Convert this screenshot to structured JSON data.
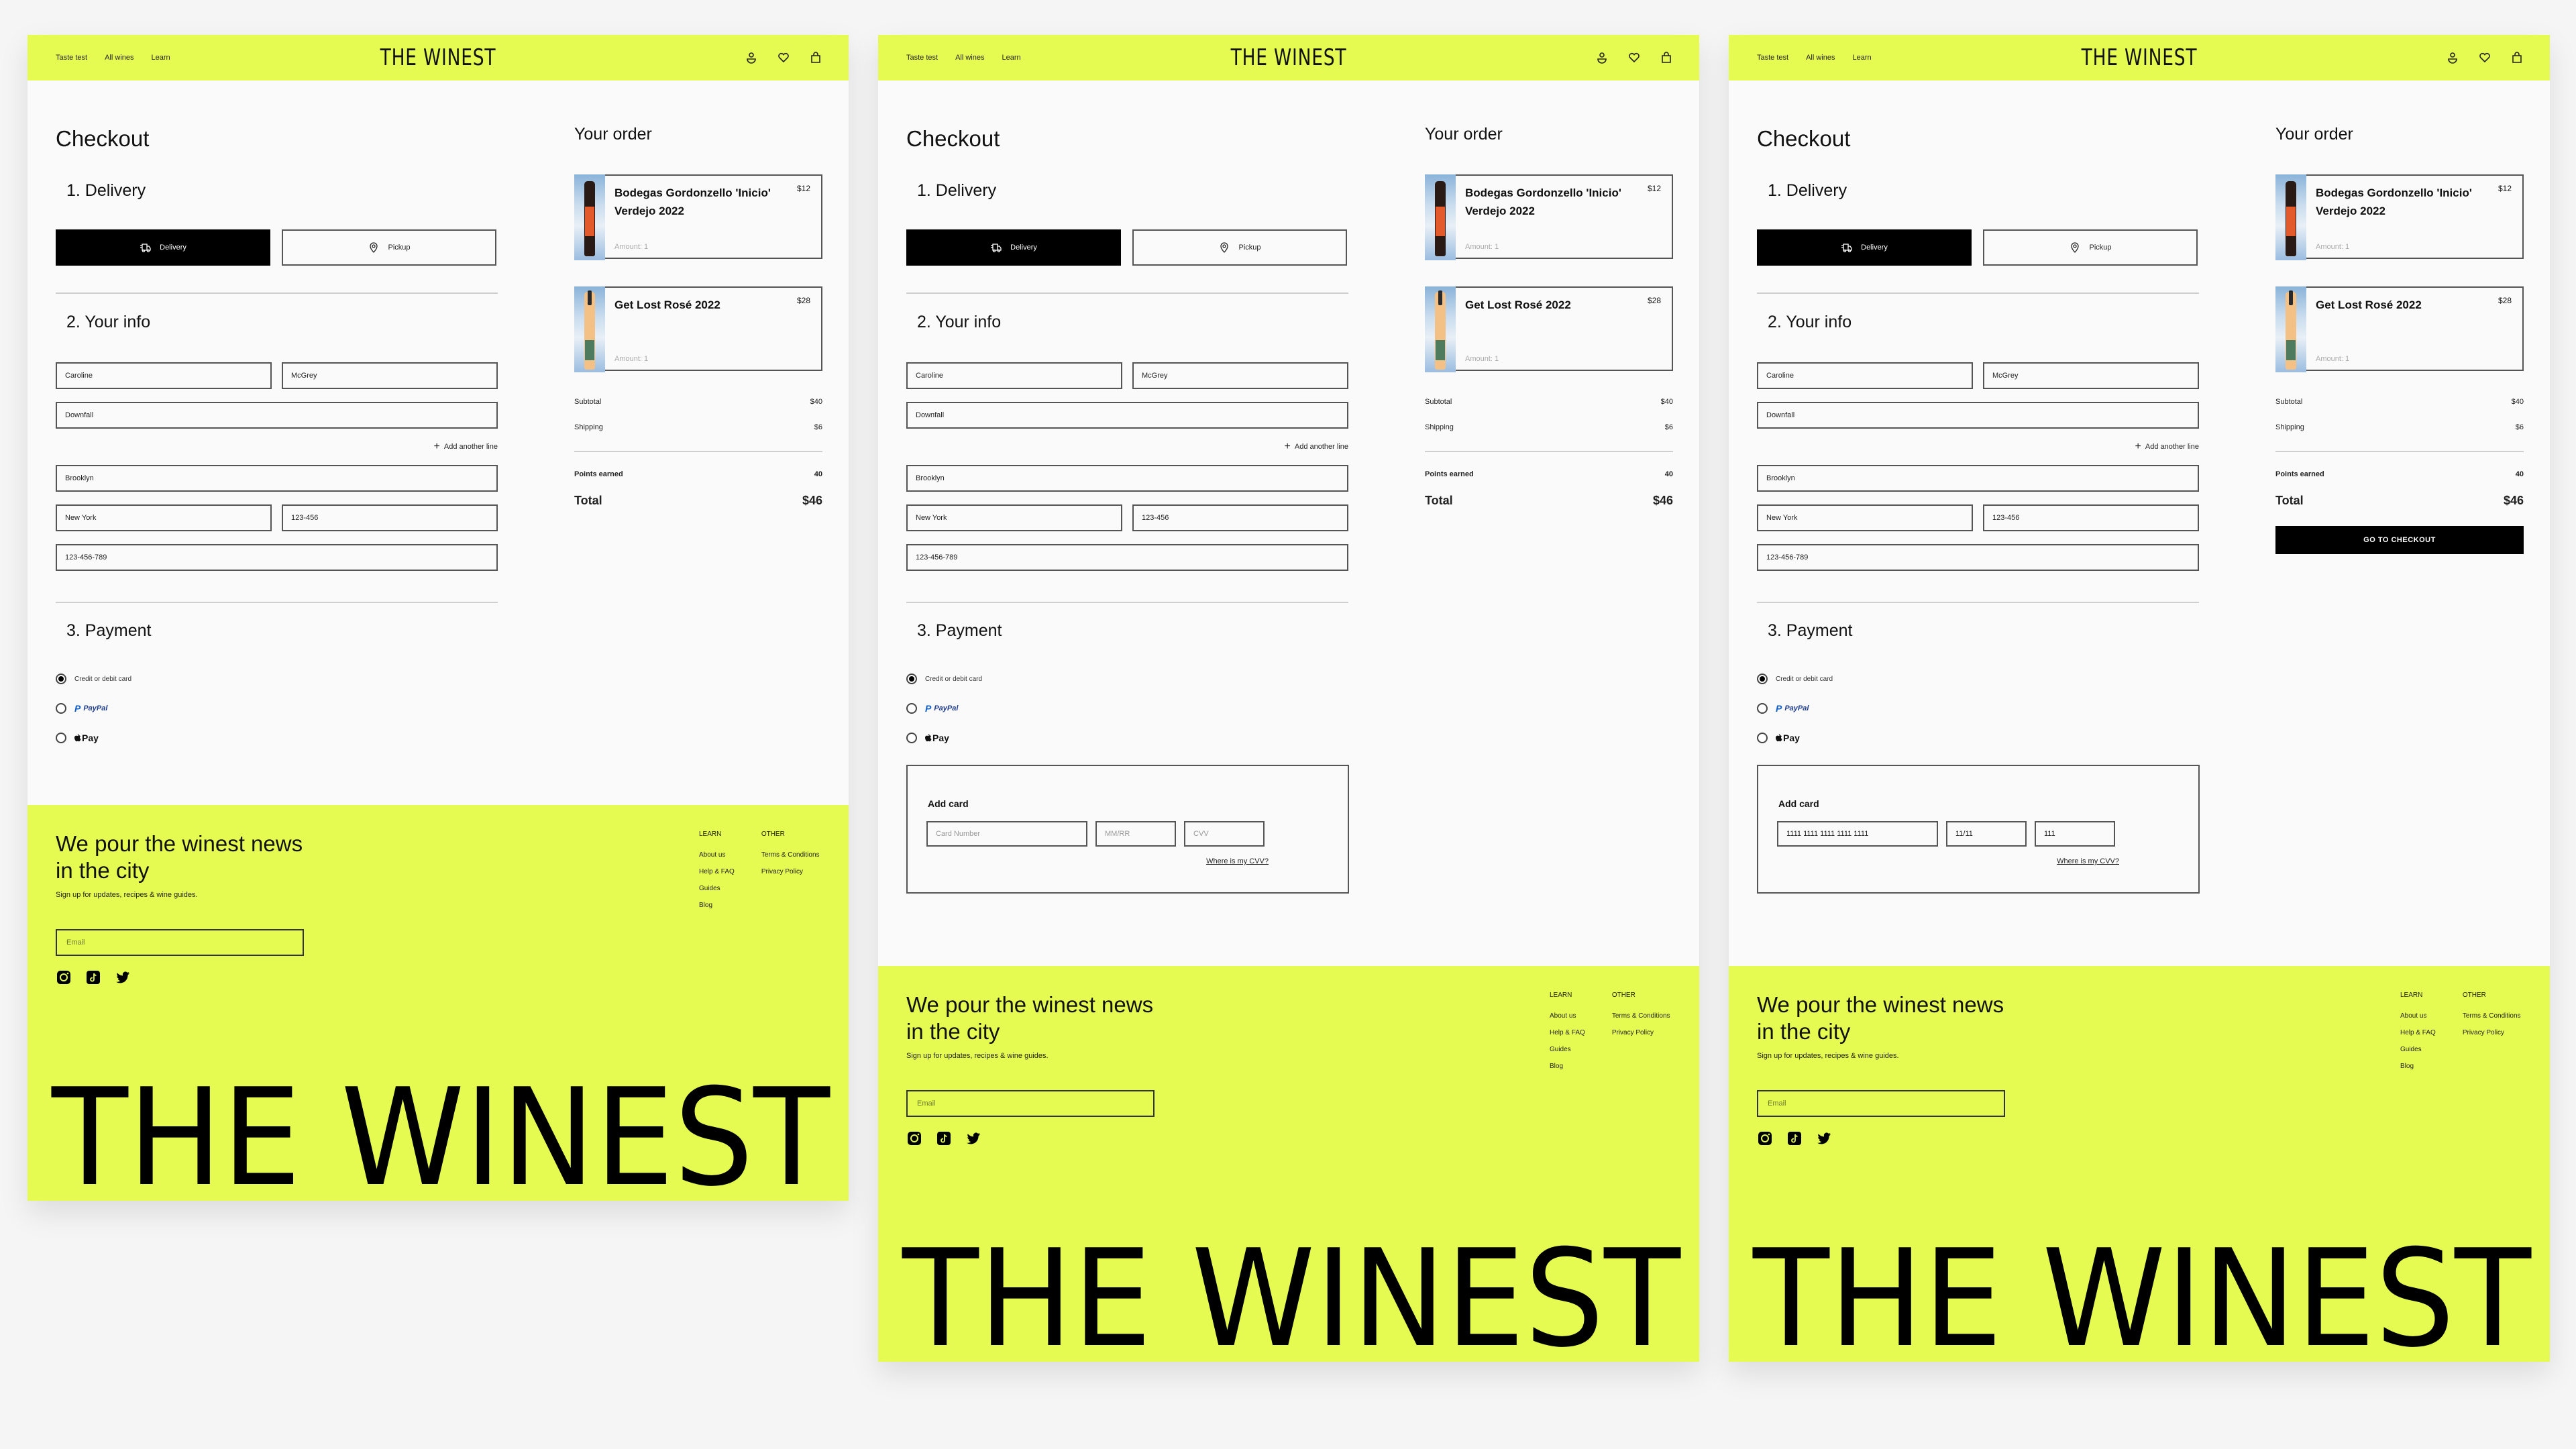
{
  "colors": {
    "accent": "#e6fb52",
    "ink": "#000000",
    "paypal_blue": "#1d3b8f"
  },
  "nav": {
    "links": [
      "Taste test",
      "All wines",
      "Learn"
    ],
    "logo": "THE WINEST",
    "icons": [
      "user-icon",
      "heart-icon",
      "bag-icon"
    ]
  },
  "checkout": {
    "title": "Checkout",
    "delivery": {
      "heading": "1. Delivery",
      "options": [
        {
          "label": "Delivery",
          "icon": "truck-icon",
          "selected": true
        },
        {
          "label": "Pickup",
          "icon": "location-pin-icon",
          "selected": false
        }
      ]
    },
    "info": {
      "heading": "2. Your info",
      "first_name": "Caroline",
      "last_name": "McGrey",
      "address": "Downfall",
      "add_line": "Add another line",
      "city": "Brooklyn",
      "state": "New York",
      "zip": "123-456",
      "phone": "123-456-789"
    },
    "payment": {
      "heading": "3. Payment",
      "options": [
        {
          "label": "Credit or debit card",
          "selected": true
        },
        {
          "label": "PayPal",
          "selected": false
        },
        {
          "label": "Pay",
          "selected": false
        }
      ],
      "add_card": {
        "title": "Add card",
        "card_number_placeholder": "Card Number",
        "expiry_placeholder": "MM/RR",
        "cvv_placeholder": "CVV",
        "card_number_value": "1111 1111 1111 1111 1111",
        "expiry_value": "11/11",
        "cvv_value": "111",
        "cvv_help": "Where is my CVV?"
      }
    }
  },
  "order": {
    "title": "Your order",
    "items": [
      {
        "name": "Bodegas Gordonzello 'Inicio' Verdejo 2022",
        "price": "$12",
        "amount": "Amount: 1"
      },
      {
        "name": "Get Lost Rosé 2022",
        "price": "$28",
        "amount": "Amount: 1"
      }
    ],
    "subtotal_label": "Subtotal",
    "subtotal": "$40",
    "shipping_label": "Shipping",
    "shipping": "$6",
    "points_label": "Points earned",
    "points": "40",
    "total_label": "Total",
    "total": "$46",
    "checkout_button": "GO TO CHECKOUT"
  },
  "footer": {
    "tagline": "We pour the winest news in the city",
    "subtitle": "Sign up for updates, recipes & wine guides.",
    "email_placeholder": "Email",
    "social": [
      "instagram-icon",
      "tiktok-icon",
      "twitter-icon"
    ],
    "learn_heading": "LEARN",
    "learn_links": [
      "About us",
      "Help & FAQ",
      "Guides",
      "Blog"
    ],
    "other_heading": "OTHER",
    "other_links": [
      "Terms & Conditions",
      "Privacy Policy"
    ],
    "wordmark": "THE WINEST"
  }
}
